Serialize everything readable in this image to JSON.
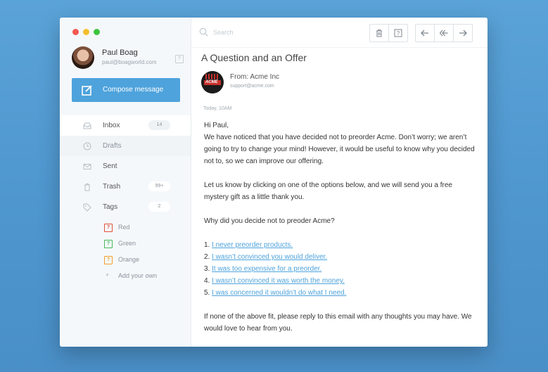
{
  "profile": {
    "name": "Paul Boag",
    "email": "paul@boagworld.com"
  },
  "compose": {
    "label": "Compose message"
  },
  "nav": [
    {
      "label": "Inbox",
      "icon": "inbox-icon",
      "badge": "14"
    },
    {
      "label": "Drafts",
      "icon": "clock-icon",
      "badge": ""
    },
    {
      "label": "Sent",
      "icon": "envelope-icon",
      "badge": ""
    },
    {
      "label": "Trash",
      "icon": "trash-icon",
      "badge": "99+"
    },
    {
      "label": "Tags",
      "icon": "tag-icon",
      "badge": "2"
    }
  ],
  "tags": [
    {
      "label": "Red",
      "color": "#e0503a"
    },
    {
      "label": "Green",
      "color": "#46b85a"
    },
    {
      "label": "Orange",
      "color": "#f0a02a"
    }
  ],
  "tags_add": "Add your own",
  "search": {
    "placeholder": "Search"
  },
  "email": {
    "subject": "A Question and an Offer",
    "from": "From: Acme Inc",
    "from_email": "support@acme.com",
    "logo_text": "ACME",
    "date": "Today, 10AM",
    "greeting": "Hi Paul,",
    "para1": "We have noticed that you have decided not to preorder Acme. Don’t worry; we aren’t going to try to change your mind! However, it would be useful to know why you decided not to, so we can improve our offering.",
    "para2": "Let us know by clicking on one of the options below, and we will send you a free mystery gift as a little thank you.",
    "question": "Why did you decide not to preoder Acme?",
    "options": [
      {
        "num": "1.",
        "text": "I never preorder products."
      },
      {
        "num": "2.",
        "text": "I wasn’t convinced you would deliver."
      },
      {
        "num": "3.",
        "text": "It was too expensive for a preorder."
      },
      {
        "num": "4.",
        "text": "I wasn’t convinced it was worth the money."
      },
      {
        "num": "5.",
        "text": "I was concerned it wouldn’t do what I need."
      }
    ],
    "closing": "If none of the above fit, please reply to this email with any thoughts you may have. We would love to hear from you."
  },
  "colors": {
    "accent": "#4ea3dc",
    "background": "#5aa3d8"
  }
}
